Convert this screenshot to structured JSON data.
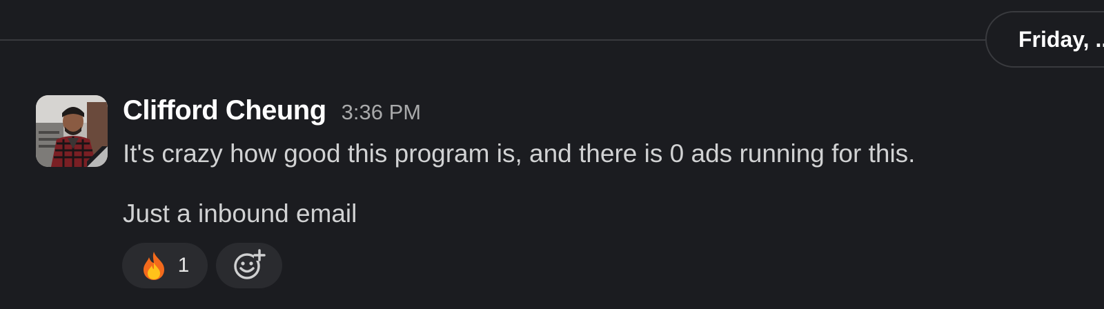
{
  "day_divider": {
    "label": "Friday, ..."
  },
  "message": {
    "sender": "Clifford Cheung",
    "timestamp": "3:36 PM",
    "lines": [
      "It's crazy how good this program is, and there is 0 ads running for this.",
      "Just a inbound email"
    ],
    "avatar_icon": "user-avatar-photo"
  },
  "reactions": [
    {
      "emoji": "🔥",
      "icon": "fire-icon",
      "count": "1"
    }
  ],
  "add_reaction": {
    "icon": "add-emoji-icon"
  },
  "colors": {
    "background": "#1b1c20",
    "divider": "#393a3e",
    "pill_bg": "#2a2b2f",
    "text_primary": "#ffffff",
    "text_body": "#d1d2d3",
    "text_muted": "#a9aaab"
  }
}
